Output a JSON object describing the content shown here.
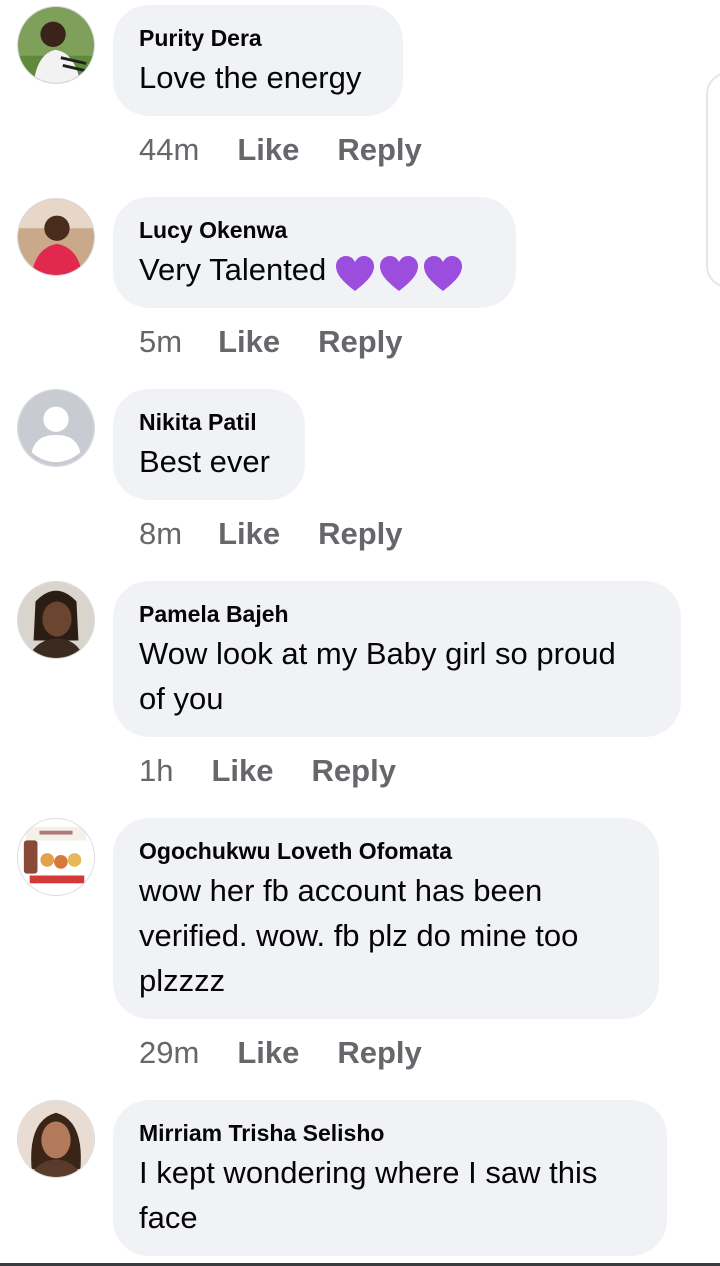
{
  "comments": [
    {
      "author": "Purity Dera",
      "text": "Love the energy",
      "time": "44m",
      "like": "Like",
      "reply": "Reply",
      "avatar": "green-outdoor-photo"
    },
    {
      "author": "Lucy Okenwa",
      "text": "Very Talented",
      "emoji": [
        "purple-heart",
        "purple-heart",
        "purple-heart"
      ],
      "time": "5m",
      "like": "Like",
      "reply": "Reply",
      "avatar": "red-top-photo"
    },
    {
      "author": "Nikita Patil",
      "text": "Best ever",
      "time": "8m",
      "like": "Like",
      "reply": "Reply",
      "avatar": "default-silhouette"
    },
    {
      "author": "Pamela Bajeh",
      "text_lines": [
        "Wow look at my Baby girl so proud",
        "of you"
      ],
      "time": "1h",
      "like": "Like",
      "reply": "Reply",
      "avatar": "portrait-photo"
    },
    {
      "author": "Ogochukwu Loveth Ofomata",
      "text_lines": [
        "wow her fb account has been",
        "verified.  wow. fb plz do mine too",
        "plzzzz"
      ],
      "time": "29m",
      "like": "Like",
      "reply": "Reply",
      "avatar": "business-flyer"
    },
    {
      "author": "Mirriam Trisha Selisho",
      "text_lines": [
        "I kept wondering where I saw this",
        "face"
      ],
      "avatar": "portrait-photo-brown"
    }
  ],
  "colors": {
    "bubble": "#f0f2f5",
    "author_text": "#050505",
    "meta_text": "#65676b",
    "heart": "#9b4dde"
  }
}
